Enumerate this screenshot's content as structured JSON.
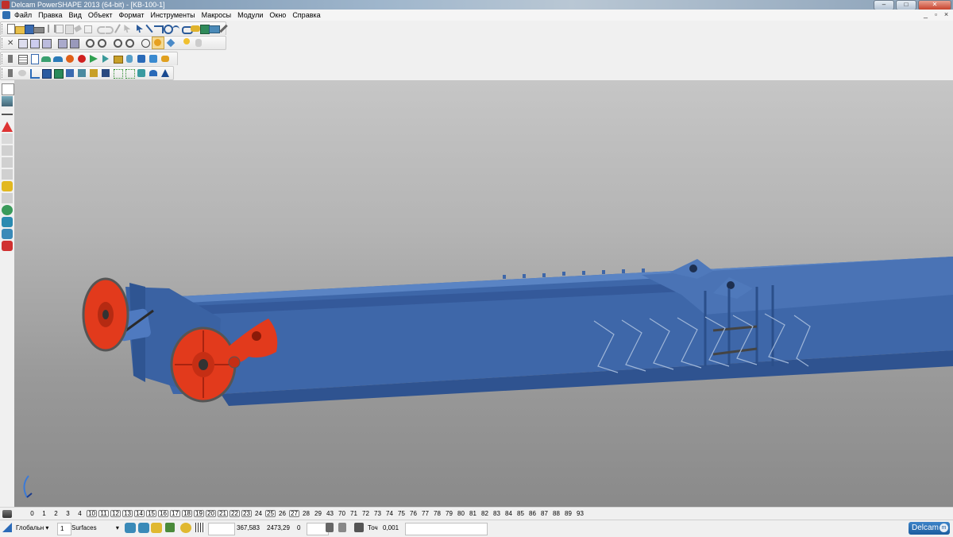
{
  "window": {
    "title": "Delcam PowerSHAPE 2013 (64-bit) - [KB-100-1]",
    "minimize": "–",
    "maximize": "□",
    "close": "✕"
  },
  "menu": {
    "items": [
      "Файл",
      "Правка",
      "Вид",
      "Объект",
      "Формат",
      "Инструменты",
      "Макросы",
      "Модули",
      "Окно",
      "Справка"
    ],
    "mdi_minimize": "_",
    "mdi_restore": "▫",
    "mdi_close": "×"
  },
  "colors": {
    "model_blue": "#3e67a9",
    "model_red": "#e23a1c",
    "viewport_bg": "#b4b4b4"
  },
  "levels": {
    "items": [
      "0",
      "1",
      "2",
      "3",
      "4",
      "10",
      "11",
      "12",
      "13",
      "14",
      "15",
      "16",
      "17",
      "18",
      "19",
      "20",
      "21",
      "22",
      "23",
      "24",
      "25",
      "26",
      "27",
      "28",
      "29",
      "43",
      "70",
      "71",
      "72",
      "73",
      "74",
      "75",
      "76",
      "77",
      "78",
      "79",
      "80",
      "81",
      "82",
      "83",
      "84",
      "85",
      "86",
      "87",
      "88",
      "89",
      "93"
    ],
    "boxed": [
      "10",
      "11",
      "12",
      "13",
      "14",
      "15",
      "16",
      "17",
      "18",
      "19",
      "20",
      "21",
      "22",
      "23",
      "25",
      "27"
    ]
  },
  "status": {
    "workplane": "Глобальн",
    "general_value": "1",
    "object_type": "Surfaces",
    "coord_x": "367,583",
    "coord_y": "2473,29",
    "coord_z": "0",
    "tolerance_label": "Точ",
    "tolerance": "0,001",
    "brand": "Delcam",
    "brand_badge": "m"
  }
}
